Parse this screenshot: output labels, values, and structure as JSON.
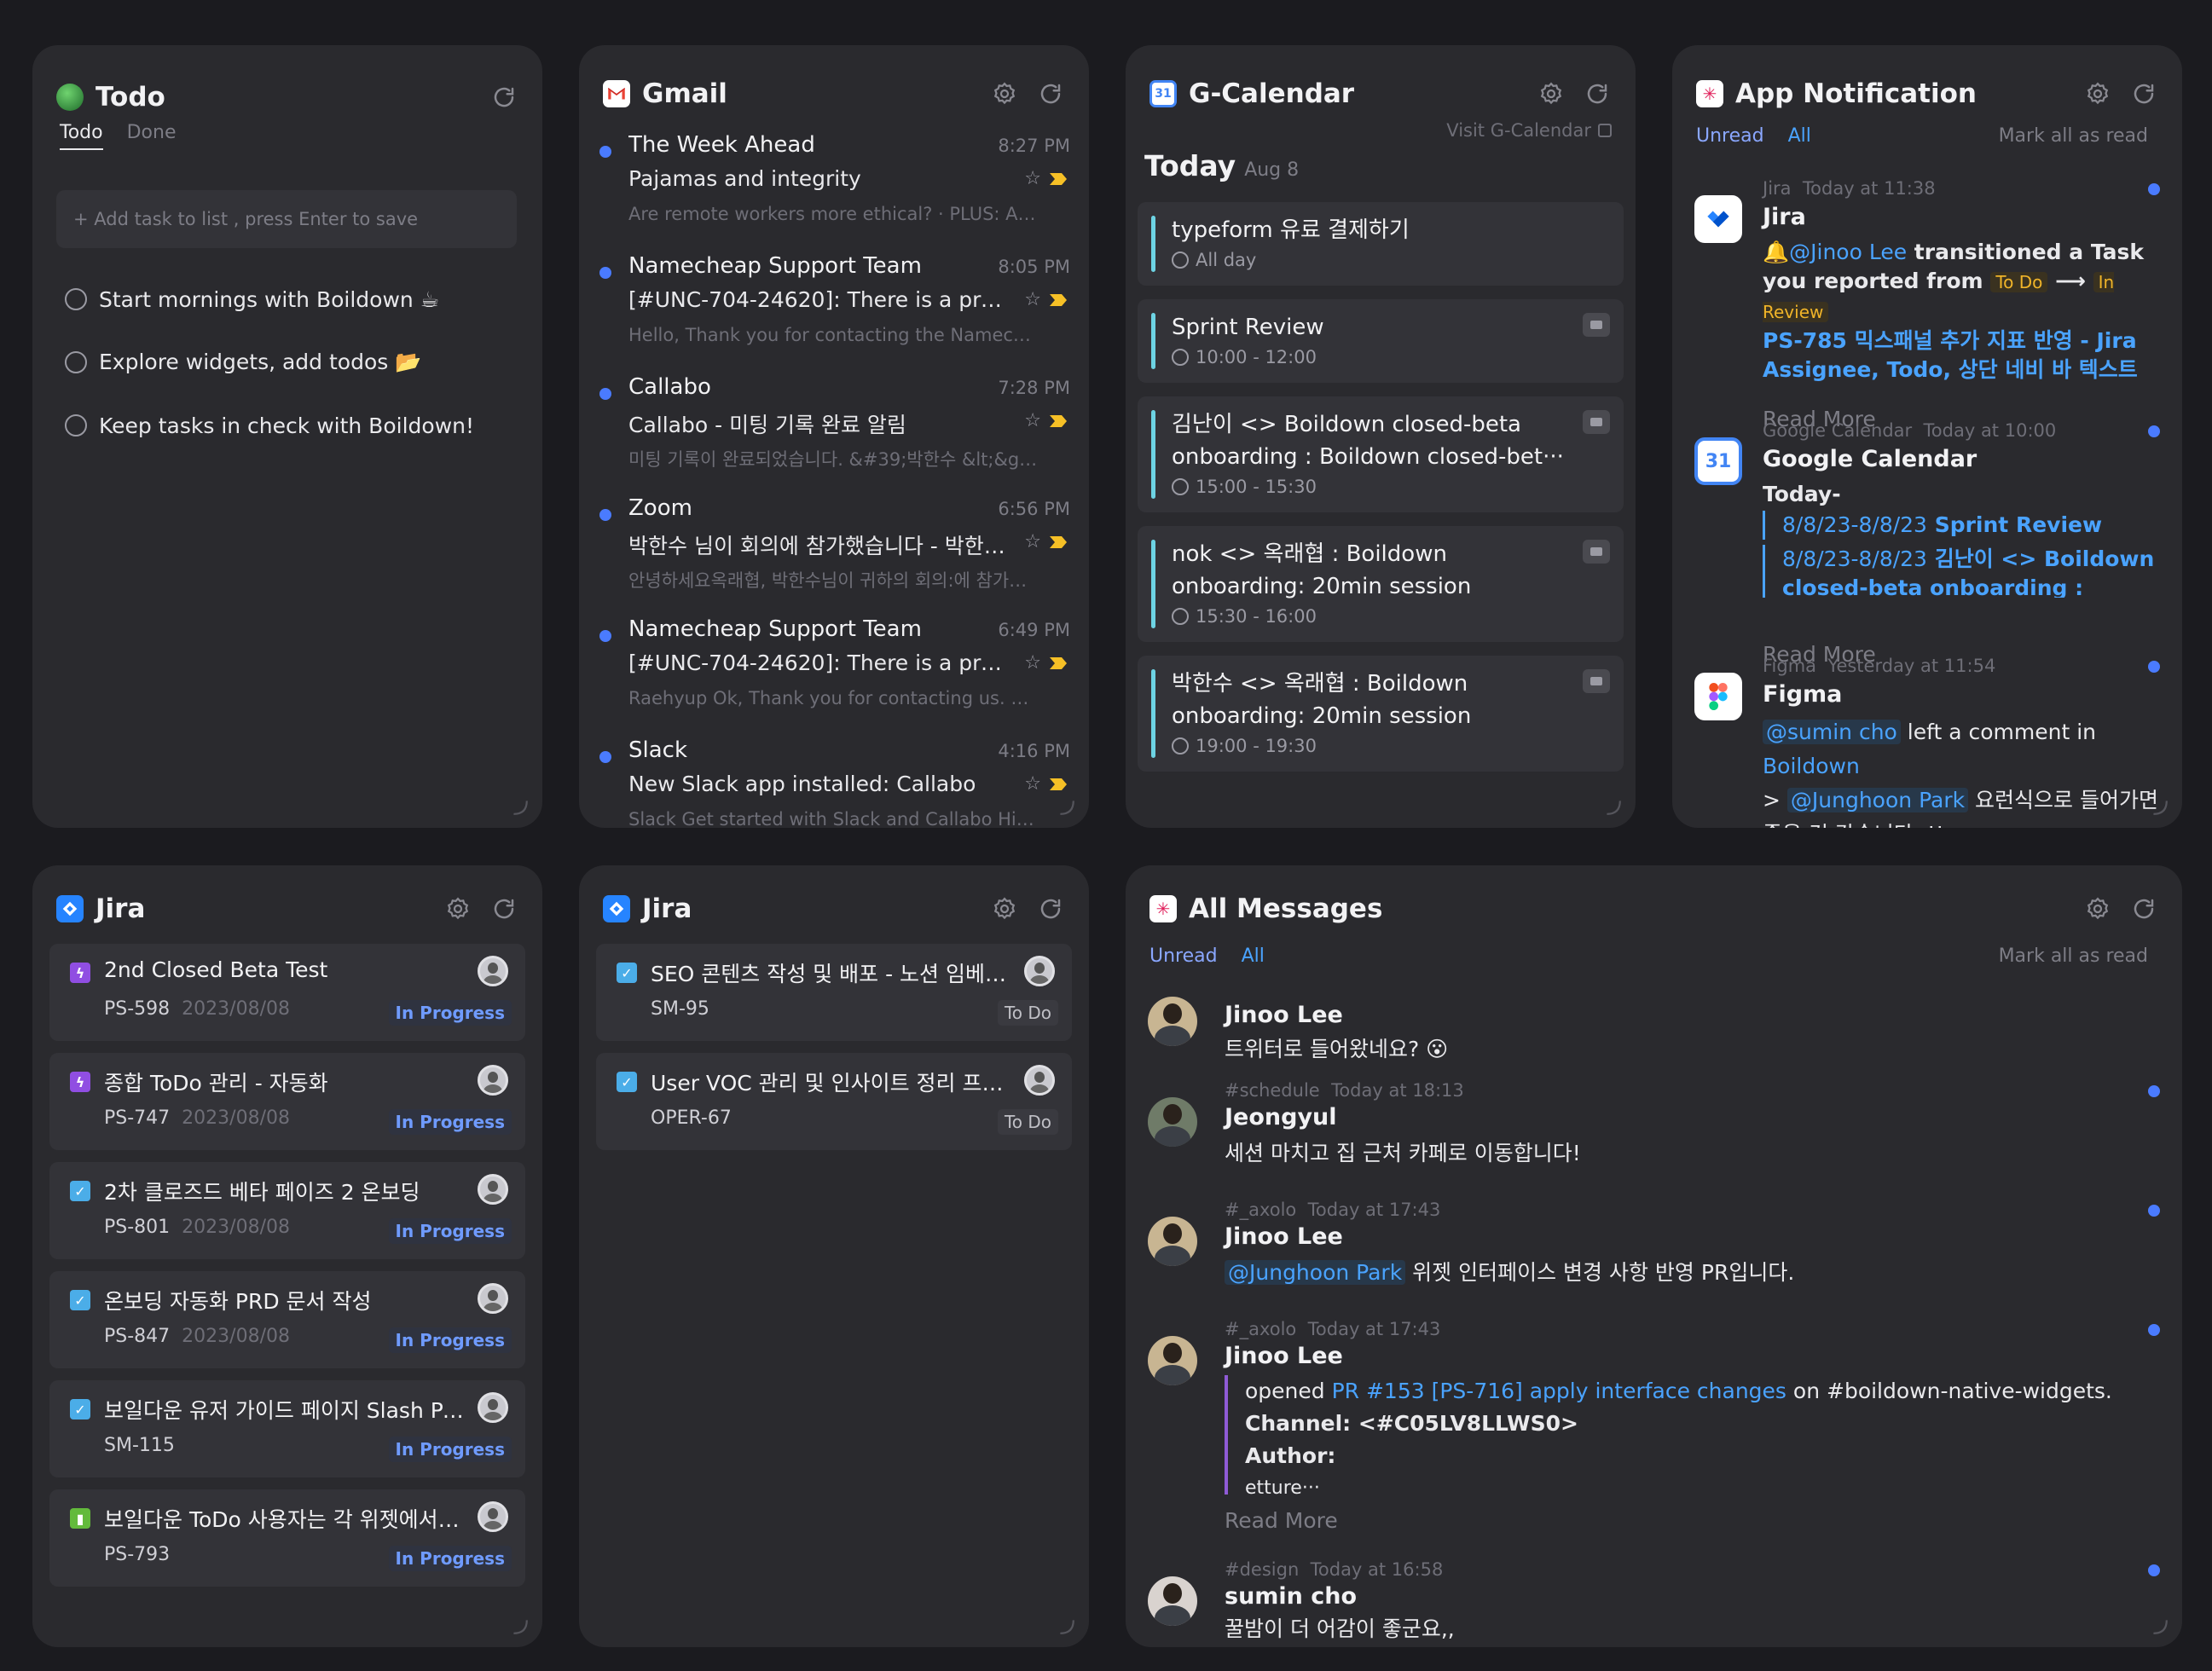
{
  "todo": {
    "title": "Todo",
    "tabs": [
      "Todo",
      "Done"
    ],
    "input_placeholder": "+ Add task to list , press Enter to save",
    "items": [
      "Start mornings with Boildown ☕",
      "Explore widgets, add todos 📂",
      "Keep tasks in check with Boildown!"
    ]
  },
  "gmail": {
    "title": "Gmail",
    "mails": [
      {
        "from": "The Week Ahead",
        "time": "8:27 PM",
        "subject": "Pajamas and integrity",
        "snippet": "Are remote workers more ethical? · PLUS: AI ···"
      },
      {
        "from": "Namecheap Support Team",
        "time": "8:05 PM",
        "subject": "[#UNC-704-24620]: There is a proble···",
        "snippet": "Hello, Thank you for contacting the Nameche···"
      },
      {
        "from": "Callabo",
        "time": "7:28 PM",
        "subject": "Callabo - 미팅 기록 완료 알림",
        "snippet": "미팅 기록이 완료되었습니다. &#39;박한수 &lt;&gt···"
      },
      {
        "from": "Zoom",
        "time": "6:56 PM",
        "subject": "박한수 님이 회의에 참가했습니다 - 박한수 <···",
        "snippet": "안녕하세요옥래협, 박한수님이 귀하의 회의:에 참가했···"
      },
      {
        "from": "Namecheap Support Team",
        "time": "6:49 PM",
        "subject": "[#UNC-704-24620]: There is a proble···",
        "snippet": "Raehyup Ok, Thank you for contacting us. Thi···"
      },
      {
        "from": "Slack",
        "time": "4:16 PM",
        "subject": "New Slack app installed: Callabo",
        "snippet": "Slack Get started with Slack and Callabo Hi R···"
      }
    ]
  },
  "calendar": {
    "title": "G-Calendar",
    "visit_link": "Visit G-Calendar",
    "today_label": "Today",
    "today_date": "Aug 8",
    "events": [
      {
        "name": "typeform 유료 결제하기",
        "when": "All day",
        "has_video": false
      },
      {
        "name": "Sprint Review",
        "when": "10:00 - 12:00",
        "has_video": true
      },
      {
        "name": "김난이 <> Boildown closed-beta onboarding : Boildown closed-bet···",
        "when": "15:00 - 15:30",
        "has_video": true
      },
      {
        "name": "nok <> 옥래협 : Boildown onboarding: 20min session",
        "when": "15:30 - 16:00",
        "has_video": true
      },
      {
        "name": "박한수 <> 옥래협 : Boildown onboarding: 20min session",
        "when": "19:00 - 19:30",
        "has_video": true
      }
    ]
  },
  "app_notification": {
    "title": "App Notification",
    "tabs": [
      "Unread",
      "All"
    ],
    "mark_all": "Mark all as read",
    "read_more": "Read More",
    "jira": {
      "meta_app": "Jira",
      "meta_time": "Today at 11:38",
      "app": "Jira",
      "bell": "🔔",
      "mention": "@Jinoo Lee",
      "action": " transitioned a Task you reported from ",
      "from_status": "To Do",
      "arrow": "⟶",
      "to_status": "In Review",
      "link": "PS-785 믹스패널 추가 지표 반영 - Jira Assignee, Todo, 상단 네비 바 텍스트 버튼 ···"
    },
    "gcal": {
      "meta_app": "Google Calendar",
      "meta_time": "Today at 10:00",
      "app": "Google Calendar",
      "line1": "Today-",
      "q1_date": "8/8/23-8/8/23",
      "q1_text": "Sprint Review",
      "q2_date": "8/8/23-8/8/23",
      "q2_text": "김난이 <> Boildown closed-beta onboarding : Boildown···"
    },
    "figma": {
      "meta_app": "Figma",
      "meta_time": "Yesterday at 11:54",
      "app": "Figma",
      "mention1": "@sumin cho",
      "t1": " left a comment in ",
      "link1": "Boildown",
      "t2": "> ",
      "mention2": "@Junghoon Park",
      "t3": " 요런식으로 들어가면 좋을 것 같습니다..!!"
    }
  },
  "jira1": {
    "title": "Jira",
    "cards": [
      {
        "title": "2nd Closed Beta Test",
        "key": "PS-598",
        "date": "2023/08/08",
        "status": "In Progress",
        "type": "epic"
      },
      {
        "title": "종합 ToDo 관리 - 자동화",
        "key": "PS-747",
        "date": "2023/08/08",
        "status": "In Progress",
        "type": "epic"
      },
      {
        "title": "2차 클로즈드 베타 페이즈 2 온보딩",
        "key": "PS-801",
        "date": "2023/08/08",
        "status": "In Progress",
        "type": "task"
      },
      {
        "title": "온보딩 자동화 PRD 문서 작성",
        "key": "PS-847",
        "date": "2023/08/08",
        "status": "In Progress",
        "type": "task"
      },
      {
        "title": "보일다운 유저 가이드 페이지 Slash Pag···",
        "key": "SM-115",
        "date": "",
        "status": "In Progress",
        "type": "task"
      },
      {
        "title": "보일다운 ToDo 사용자는 각 위젯에서 확···",
        "key": "PS-793",
        "date": "",
        "status": "In Progress",
        "type": "story"
      }
    ]
  },
  "jira2": {
    "title": "Jira",
    "cards": [
      {
        "title": "SEO 콘텐츠 작성 및 배포 - 노션 임베디···",
        "key": "SM-95",
        "status": "To Do"
      },
      {
        "title": "User VOC 관리 및 인사이트 정리 프레임···",
        "key": "OPER-67",
        "status": "To Do"
      }
    ]
  },
  "messages": {
    "title": "All Messages",
    "tabs": [
      "Unread",
      "All"
    ],
    "mark_all": "Mark all as read",
    "read_more": "Read More",
    "m1": {
      "who": "Jinoo Lee",
      "text": "트위터로 들어왔네요? 😮"
    },
    "m2": {
      "channel": "#schedule",
      "time": "Today at 18:13",
      "who": "Jeongyul",
      "text": "세션 마치고 집 근처 카페로 이동합니다!"
    },
    "m3": {
      "channel": "#_axolo",
      "time": "Today at 17:43",
      "who": "Jinoo Lee",
      "mention": "@Junghoon Park",
      "text": " 위젯 인터페이스 변경 사항 반영 PR입니다."
    },
    "m4": {
      "channel": "#_axolo",
      "time": "Today at 17:43",
      "who": "Jinoo Lee",
      "opened": "opened ",
      "pr_link": "PR #153 [PS-716] apply interface changes",
      "on": " on #boildown-native-widgets.",
      "channel_label": "Channel",
      "channel_val": " <#C05LV8LLWS0>",
      "author_label": "Author",
      "author_val": "etture···"
    },
    "m5": {
      "channel": "#design",
      "time": "Today at 16:58",
      "who": "sumin cho",
      "text": "꿀밤이 더 어감이 좋군요,,"
    }
  }
}
